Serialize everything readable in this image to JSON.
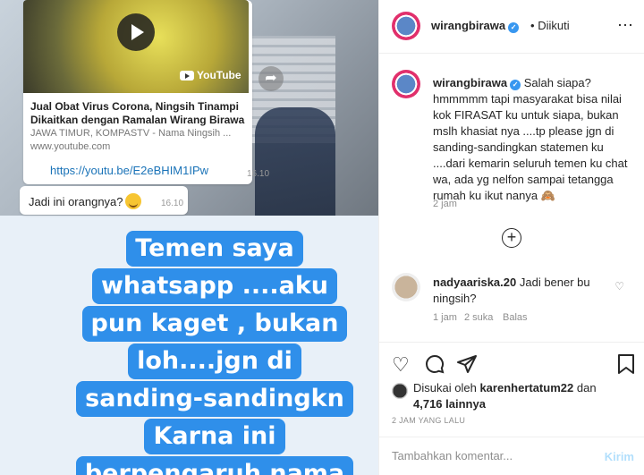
{
  "whatsapp": {
    "video_brand": "YouTube",
    "link_title": "Jual Obat Virus Corona, Ningsih Tinampi Dikaitkan dengan Ramalan Wirang Birawa",
    "link_subtitle": "JAWA TIMUR, KOMPASTV - Nama Ningsih ...",
    "link_domain": "www.youtube.com",
    "link_url": "https://youtu.be/E2eBHIM1IPw",
    "time_1": "16.10",
    "message_2": "Jadi ini orangnya?",
    "time_2": "16.10"
  },
  "caption_lines": [
    "Temen saya",
    "whatsapp ....aku",
    "pun kaget , bukan",
    "loh....jgn di",
    "sanding-sandingkn",
    "Karna ini",
    "berpengaruh nama"
  ],
  "header": {
    "username": "wirangbirawa",
    "separator": "•",
    "follow_status": "Diikuti",
    "more_icon": "⋯"
  },
  "post_comment": {
    "username": "wirangbirawa",
    "text": "Salah siapa? hmmmmm tapi masyarakat bisa nilai kok FIRASAT ku untuk siapa, bukan mslh khasiat nya ....tp please jgn di sanding-sandingkan statemen ku ....dari kemarin seluruh temen ku chat wa, ada yg nelfon sampai tetangga rumah ku ikut nanya 🙈",
    "time": "2 jam"
  },
  "load_more_icon": "+",
  "reply": {
    "username": "nadyaariska.20",
    "text": "Jadi bener bu ningsih?",
    "time": "1 jam",
    "likes": "2 suka",
    "reply_label": "Balas"
  },
  "likes": {
    "prefix": "Disukai oleh",
    "user": "karenhertatum22",
    "joiner": "dan",
    "others": "4,716 lainnya"
  },
  "posted_time": "2 JAM YANG LALU",
  "add_comment": {
    "placeholder": "Tambahkan komentar...",
    "submit_label": "Kirim"
  },
  "colors": {
    "caption_bg": "#2f8fea",
    "verified": "#3897f0",
    "link": "#1a73b8",
    "kirim": "#b2dffc"
  }
}
